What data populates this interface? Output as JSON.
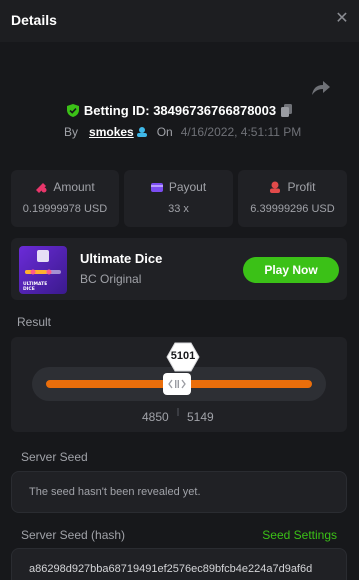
{
  "header": {
    "title": "Details"
  },
  "bet": {
    "id_label": "Betting ID: 38496736766878003",
    "by_label": "By",
    "username": "smokes",
    "on_label": "On",
    "datetime": "4/16/2022, 4:51:11 PM"
  },
  "stats": {
    "amount": {
      "label": "Amount",
      "value": "0.19999978 USD"
    },
    "payout": {
      "label": "Payout",
      "value": "33 x"
    },
    "profit": {
      "label": "Profit",
      "value": "6.39999296 USD"
    }
  },
  "game": {
    "name": "Ultimate Dice",
    "subtitle": "BC Original",
    "play_label": "Play Now",
    "thumb_text": "ULTIMATE DICE"
  },
  "result": {
    "label": "Result",
    "value": "5101",
    "range_low": "4850",
    "range_high": "5149"
  },
  "server_seed": {
    "label": "Server Seed",
    "message": "The seed hasn't been revealed yet."
  },
  "server_seed_hash": {
    "label": "Server Seed (hash)",
    "settings_label": "Seed Settings",
    "value": "a86298d927bba68719491ef2576ec89bfcb4e224a7d9af6d"
  },
  "colors": {
    "accent_green": "#3bc117",
    "slider_orange": "#ea6e0b",
    "verified_green": "#3bc117",
    "amount_icon": "#e8366b",
    "payout_icon": "#7b4df2",
    "profit_icon": "#e24a4a"
  }
}
